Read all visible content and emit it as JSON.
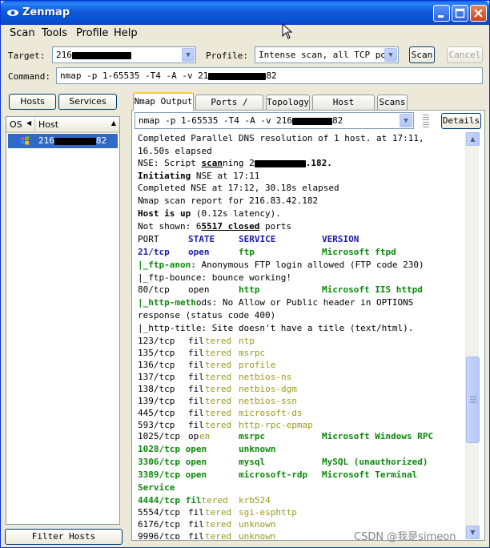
{
  "window": {
    "title": "Zenmap"
  },
  "menu": {
    "scan": "Scan",
    "tools": "Tools",
    "profile": "Profile",
    "help": "Help"
  },
  "toolbar": {
    "target_label": "Target:",
    "target_prefix": "216",
    "target_suffix": "",
    "profile_label": "Profile:",
    "profile_value": "Intense scan, all TCP port",
    "scan_label": "Scan",
    "cancel_label": "Cancel",
    "command_label": "Command:",
    "command_prefix": "nmap -p 1-65535 -T4 -A -v 21",
    "command_suffix": "82"
  },
  "left_pane": {
    "hosts_button": "Hosts",
    "services_button": "Services",
    "col_os": "OS",
    "col_host": "Host",
    "host_prefix": "216",
    "host_suffix": "82",
    "filter_button": "Filter Hosts"
  },
  "tabs": [
    "Nmap Output",
    "Ports / Hosts",
    "Topology",
    "Host Details",
    "Scans"
  ],
  "output_panel": {
    "scan_select_prefix": "nmap -p 1-65535 -T4 -A -v 216",
    "scan_select_suffix": "82",
    "details_button": "Details"
  },
  "output": {
    "l1": "Completed Parallel DNS resolution of 1 host. at 17:11,",
    "l2": "16.50s elapsed",
    "l3a": "NSE: Script ",
    "l3b": "scan",
    "l3c": "ning 2",
    "l3d": ".182.",
    "l4a": "Initiating",
    "l4b": " NSE at 17:11",
    "l5": "Completed NSE at 17:12, 30.18s elapsed",
    "l6": "Nmap scan report for 216.83.42.182",
    "l7a": "Host is up",
    "l7b": " (0.12s latency).",
    "l8a": "Not shown: 6",
    "l8b": "5517 closed",
    "l8c": " ports",
    "hdr_port": "PORT",
    "hdr_state": "STATE",
    "hdr_service": "SERVICE",
    "hdr_version": "VERSION",
    "p21": "21/tcp",
    "p21_state": "open",
    "p21_svc": "ftp",
    "p21_ver": "Microsoft ftpd",
    "ftp_anon_a": "|_ftp-anon:",
    "ftp_anon_b": " Anonymous FTP login allowed (FTP code 230)",
    "ftp_bounce": "|_ftp-bounce: bounce working!",
    "p80": "80/tcp",
    "p80_state": "open",
    "p80_svc": "http",
    "p80_ver": "Microsoft IIS httpd",
    "http_methods_a": "|_http-meth",
    "http_methods_b": "ods: No Allow or Public header in OPTIONS",
    "http_methods_c": "response (status code 400)",
    "http_title": "|_http-title: Site doesn't have a title (text/html).",
    "filtered": [
      {
        "port": "123/tcp",
        "svc": "ntp"
      },
      {
        "port": "135/tcp",
        "svc": "msrpc"
      },
      {
        "port": "136/tcp",
        "svc": "profile"
      },
      {
        "port": "137/tcp",
        "svc": "netbios-ns"
      },
      {
        "port": "138/tcp",
        "svc": "netbios-dgm"
      },
      {
        "port": "139/tcp",
        "svc": "netbios-ssn"
      },
      {
        "port": "445/tcp",
        "svc": "microsoft-ds"
      },
      {
        "port": "593/tcp",
        "svc": "http-rpc-epmap"
      }
    ],
    "fil_a": "fil",
    "fil_b": "tered",
    "p1025": "1025/tcp",
    "p1025_state_a": "op",
    "p1025_state_b": "en",
    "p1025_svc": "msrpc",
    "p1025_ver": "Microsoft Windows RPC",
    "p1028": "1028/tcp open",
    "p1028_svc": "unknown",
    "p3306": "3306/tcp open",
    "p3306_svc": "mysql",
    "p3306_ver": "MySQL (unauthorized)",
    "p3389": "3389/tcp open",
    "p3389_svc": "microsoft-rdp",
    "p3389_ver": "Microsoft Terminal",
    "p3389_ver2": "Service",
    "p4444": "4444/tcp fil",
    "p4444_b": "tered",
    "p4444_svc": "krb524",
    "p5554": "5554/tcp",
    "p5554_svc": "sgi-esphttp",
    "p6176": "6176/tcp",
    "p6176_svc": "unknown",
    "p9996": "9996/tcp",
    "p9996_svc": "unknown"
  },
  "watermark": "CSDN @我是simeon",
  "colors": {
    "titlebar": "#0a5fe0",
    "selection": "#316ac5",
    "open_port": "#1a1aaa",
    "service_green": "#0a8a0a",
    "filtered_olive": "#9a9a1a"
  }
}
